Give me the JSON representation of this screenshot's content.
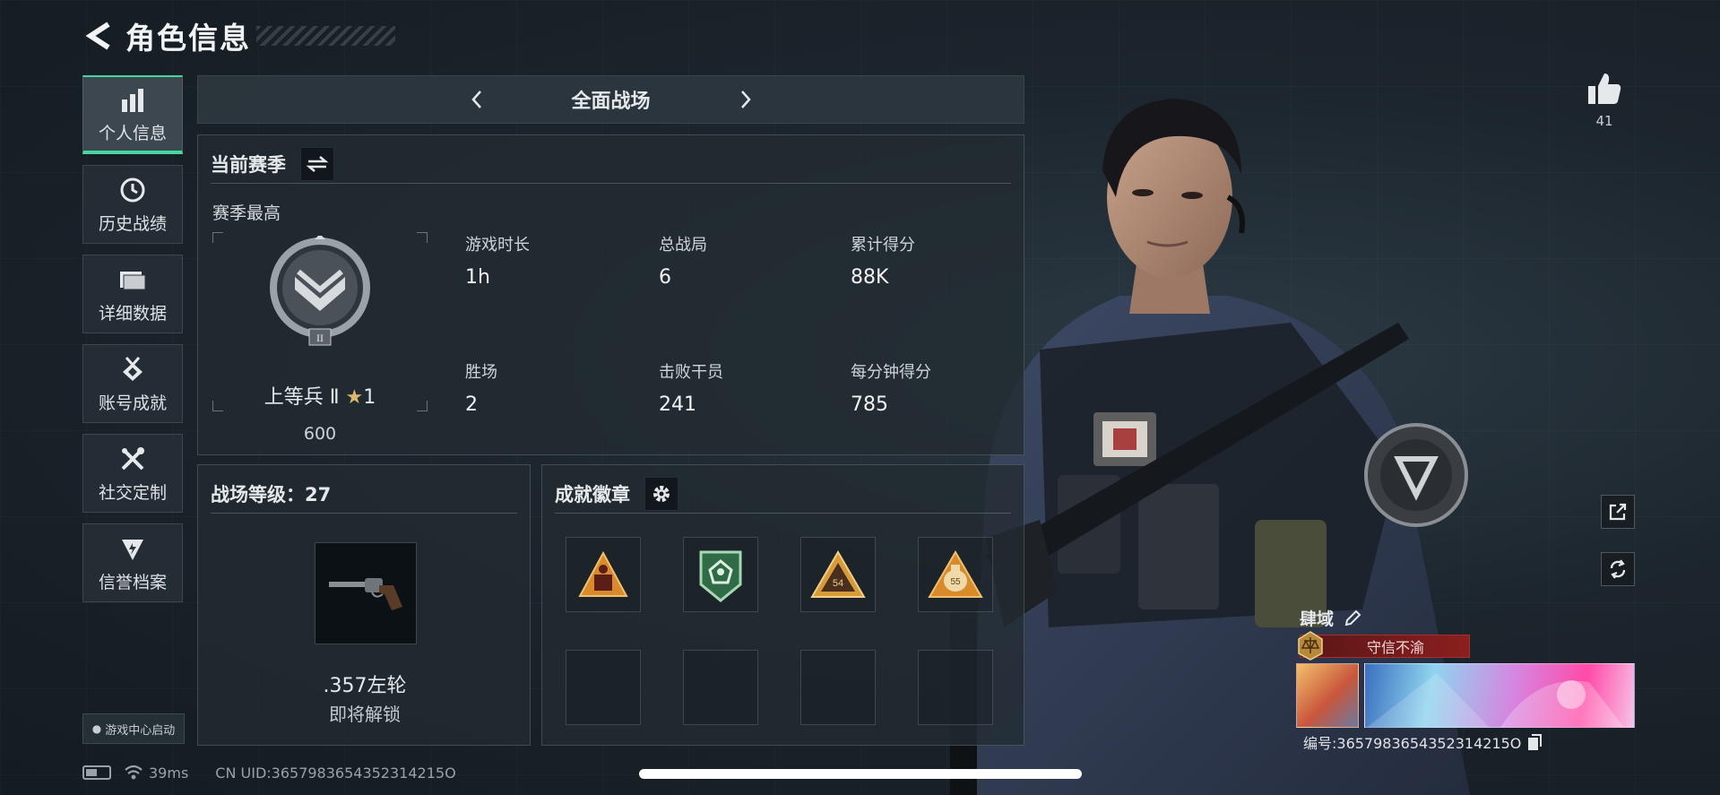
{
  "header": {
    "title": "角色信息"
  },
  "sidebar": {
    "items": [
      {
        "label": "个人信息",
        "icon": "bar-chart-icon",
        "active": true
      },
      {
        "label": "历史战绩",
        "icon": "clock-icon"
      },
      {
        "label": "详细数据",
        "icon": "folder-icon"
      },
      {
        "label": "账号成就",
        "icon": "medal-icon"
      },
      {
        "label": "社交定制",
        "icon": "tools-icon"
      },
      {
        "label": "信誉档案",
        "icon": "shield-icon"
      }
    ],
    "launch_label": "游戏中心启动"
  },
  "mode": {
    "title": "全面战场"
  },
  "season": {
    "title": "当前赛季",
    "subtitle": "赛季最高",
    "rank_name": "上等兵 Ⅱ",
    "rank_stars": "1",
    "rank_points": "600",
    "emblem_tier": "II",
    "stats": [
      {
        "label": "游戏时长",
        "value": "1h"
      },
      {
        "label": "总战局",
        "value": "6"
      },
      {
        "label": "累计得分",
        "value": "88K"
      },
      {
        "label": "胜场",
        "value": "2"
      },
      {
        "label": "击败干员",
        "value": "241"
      },
      {
        "label": "每分钟得分",
        "value": "785"
      }
    ]
  },
  "level": {
    "title": "战场等级：27",
    "weapon_name": ".357左轮",
    "weapon_status": "即将解锁"
  },
  "achievements": {
    "title": "成就徽章",
    "badges": [
      {
        "type": "triangle-orange",
        "text": ""
      },
      {
        "type": "shield-green",
        "text": ""
      },
      {
        "type": "triangle-tan",
        "text": "54"
      },
      {
        "type": "triangle-bag",
        "text": "55"
      }
    ],
    "empty_slots": 4
  },
  "profile": {
    "like_count": "41",
    "player_name": "肆域",
    "player_title": "守信不渝",
    "uid_label": "编号:3657983654352314215O"
  },
  "footer": {
    "ping": "39ms",
    "uid": "CN UID:3657983654352314215O"
  },
  "colors": {
    "accent": "#46d6a1",
    "title_red": "#8b1f1f",
    "badge_orange": "#d98a2b",
    "badge_green": "#2f6b46"
  }
}
